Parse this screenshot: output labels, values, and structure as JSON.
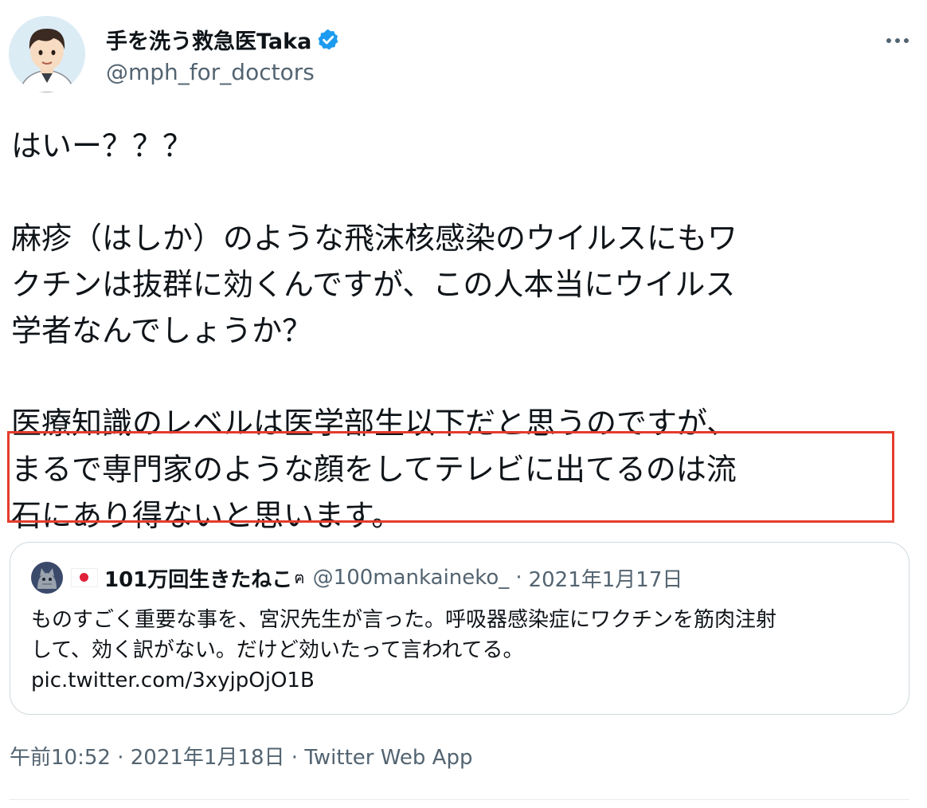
{
  "author": {
    "display_name": "手を洗う救急医Taka",
    "handle": "@mph_for_doctors",
    "verified": true,
    "avatar_icon": "doctor-avatar-illustration"
  },
  "tweet": {
    "lines": [
      "はいー？？？",
      "",
      "麻疹（はしか）のような飛沫核感染のウイルスにもワ",
      "クチンは抜群に効くんですが、この人本当にウイルス",
      "学者なんでしょうか？",
      "",
      "医療知識のレベルは医学部生以下だと思うのですが、",
      "まるで専門家のような顔をしてテレビに出てるのは流",
      "石にあり得ないと思います。"
    ]
  },
  "quote": {
    "display_name": "101万回生きたねこ",
    "flag_icon": "japan-flag-icon",
    "name_emoji": "ฅ",
    "handle": "@100mankaineko_",
    "separator": "·",
    "date": "2021年1月17日",
    "lines": [
      "ものすごく重要な事を、宮沢先生が言った。呼吸器感染症にワクチンを筋肉注射",
      "して、効く訳がない。だけど効いたって言われてる。",
      "pic.twitter.com/3xyjpOjO1B"
    ]
  },
  "meta": {
    "time": "午前10:52",
    "separator": "·",
    "date": "2021年1月18日",
    "source": "Twitter Web App"
  },
  "colors": {
    "highlight_border": "#e53b2c",
    "verified_badge": "#1d9bf0",
    "secondary_text": "#536471"
  }
}
